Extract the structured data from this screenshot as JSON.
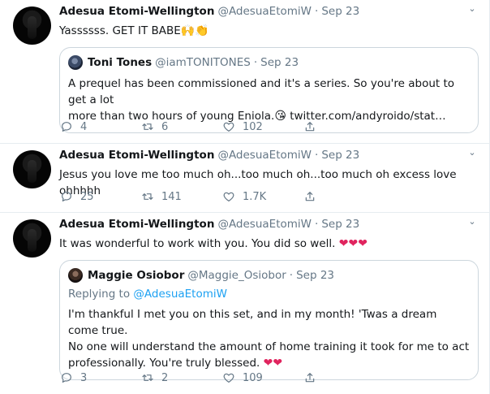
{
  "tweets": [
    {
      "name": "Adesua Etomi-Wellington",
      "handle": "@AdesuaEtomiW",
      "sep": "·",
      "date": "Sep 23",
      "text": "Yassssss. GET IT BABE",
      "emoji": "🙌👏",
      "quote": {
        "name": "Toni Tones",
        "handle": "@iamTONITONES",
        "sep": "·",
        "date": "Sep 23",
        "text_line1": "A prequel has been commissioned and it's a series. So you're about to get a lot",
        "text_line2": "more than two hours of young Eniola.",
        "emoji": "😘",
        "link": " twitter.com/andyroido/stat…"
      },
      "actions": {
        "replies": "4",
        "retweets": "6",
        "likes": "102"
      }
    },
    {
      "name": "Adesua Etomi-Wellington",
      "handle": "@AdesuaEtomiW",
      "sep": "·",
      "date": "Sep 23",
      "text": "Jesus you love me too much oh...too much oh...too much oh excess love ohhhhh",
      "actions": {
        "replies": "25",
        "retweets": "141",
        "likes": "1.7K"
      }
    },
    {
      "name": "Adesua Etomi-Wellington",
      "handle": "@AdesuaEtomiW",
      "sep": "·",
      "date": "Sep 23",
      "text": "It was wonderful to work with you. You did so well.",
      "emoji": "❤❤❤",
      "quote": {
        "name": "Maggie Osiobor",
        "handle": "@Maggie_Osiobor",
        "sep": "·",
        "date": "Sep 23",
        "replying_to": "Replying to",
        "replying_handle": "@AdesuaEtomiW",
        "text_line1": "I'm thankful I met you on this set, and in my month! 'Twas a dream come true.",
        "text_line2": "No one will understand the amount of home training it took for me to act",
        "text_line3": "professionally. You're truly blessed.",
        "emoji": "❤❤"
      },
      "actions": {
        "replies": "3",
        "retweets": "2",
        "likes": "109"
      }
    }
  ],
  "icons": {
    "caret": "chevron-down-icon",
    "reply": "reply-icon",
    "retweet": "retweet-icon",
    "like": "heart-icon",
    "share": "share-icon"
  },
  "colors": {
    "secondary_text": "#657786",
    "border": "#e6ecf0",
    "heart": "#e0245e",
    "link": "#1da1f2"
  }
}
